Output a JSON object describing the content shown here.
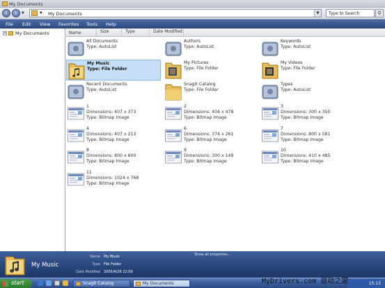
{
  "window": {
    "title": "My Documents"
  },
  "address": {
    "path": "My Documents",
    "search_placeholder": "Type to Search"
  },
  "menu": [
    "File",
    "Edit",
    "View",
    "Favorites",
    "Tools",
    "Help"
  ],
  "sidebar": {
    "root": "My Documents"
  },
  "columns": [
    "Name",
    "Size",
    "Type",
    "Date Modified"
  ],
  "items": [
    {
      "name": "All Documents",
      "line2": "Type: AutoList",
      "icon": "autolist-icon"
    },
    {
      "name": "Authors",
      "line2": "Type: AutoList",
      "icon": "autolist-icon"
    },
    {
      "name": "Keywords",
      "line2": "Type: AutoList",
      "icon": "autolist-icon"
    },
    {
      "name": "My Music",
      "line2": "Type: File Folder",
      "icon": "music-folder-icon",
      "selected": true
    },
    {
      "name": "My Pictures",
      "line2": "Type: File Folder",
      "icon": "pictures-folder-icon"
    },
    {
      "name": "My Videos",
      "line2": "Type: File Folder",
      "icon": "videos-folder-icon"
    },
    {
      "name": "Recent Documents",
      "line2": "Type: AutoList",
      "icon": "autolist-icon"
    },
    {
      "name": "SnagIt Catalog",
      "line2": "Type: File Folder",
      "icon": "folder-icon"
    },
    {
      "name": "Types",
      "line2": "Type: AutoList",
      "icon": "autolist-icon"
    },
    {
      "name": "1",
      "line2": "Dimensions: 407 x 373",
      "line3": "Type: Bitmap Image",
      "icon": "bitmap-thumbnail"
    },
    {
      "name": "2",
      "line2": "Dimensions: 404 x 478",
      "line3": "Type: Bitmap Image",
      "icon": "bitmap-thumbnail"
    },
    {
      "name": "3",
      "line2": "Dimensions: 300 x 350",
      "line3": "Type: Bitmap Image",
      "icon": "bitmap-thumbnail"
    },
    {
      "name": "4",
      "line2": "Dimensions: 407 x 213",
      "line3": "Type: Bitmap Image",
      "icon": "bitmap-thumbnail"
    },
    {
      "name": "6",
      "line2": "Dimensions: 374 x 261",
      "line3": "Type: Bitmap Image",
      "icon": "bitmap-thumbnail"
    },
    {
      "name": "7",
      "line2": "Dimensions: 800 x 581",
      "line3": "Type: Bitmap Image",
      "icon": "bitmap-thumbnail"
    },
    {
      "name": "8",
      "line2": "Dimensions: 800 x 600",
      "line3": "Type: Bitmap Image",
      "icon": "bitmap-thumbnail"
    },
    {
      "name": "9",
      "line2": "Dimensions: 300 x 149",
      "line3": "Type: Bitmap Image",
      "icon": "bitmap-thumbnail"
    },
    {
      "name": "10",
      "line2": "Dimensions: 410 x 485",
      "line3": "Type: Bitmap Image",
      "icon": "bitmap-thumbnail"
    },
    {
      "name": "11",
      "line2": "Dimensions: 1024 x 768",
      "line3": "Type: Bitmap Image",
      "icon": "bitmap-thumbnail"
    }
  ],
  "details": {
    "title": "My Music",
    "name_label": "Name",
    "name_value": "My Music",
    "type_label": "Type",
    "type_value": "File Folder",
    "date_label": "Date Modified",
    "date_value": "2005/4/26 22:09",
    "show_all": "Show all properties..."
  },
  "taskbar": {
    "start": "start",
    "tasks": [
      "SnagIt Catalog",
      "My Documents"
    ],
    "clock": "15:13"
  },
  "watermark": "MyDrivers.com 驱动之家",
  "colors": {
    "menubar": "#2f4d85",
    "selection": "#c6dff7",
    "details_pane": "#28457b",
    "taskbar": "#3a5c9a"
  }
}
